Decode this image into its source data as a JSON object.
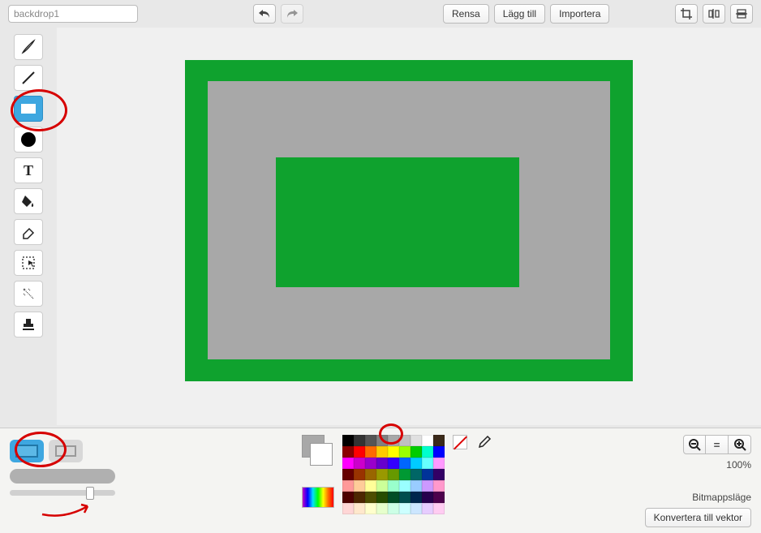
{
  "header": {
    "name_value": "backdrop1",
    "undo": "↶",
    "redo": "↷",
    "buttons": {
      "clear": "Rensa",
      "add": "Lägg till",
      "import": "Importera"
    }
  },
  "tools": {
    "brush": "brush",
    "line": "line",
    "rect": "rect",
    "ellipse": "ellipse",
    "text": "T",
    "fill": "fill",
    "erase": "erase",
    "select": "select",
    "wand": "wand",
    "stamp": "stamp"
  },
  "zoom": {
    "level": "100%"
  },
  "mode": {
    "label": "Bitmappsläge",
    "convert": "Konvertera till vektor"
  },
  "palette": [
    [
      "#000000",
      "#333333",
      "#555555",
      "#808080",
      "#a8a8a8",
      "#c0c0c0",
      "#e0e0e0",
      "#ffffff",
      "#3b2a1a"
    ],
    [
      "#8b0000",
      "#ff0000",
      "#ff6a00",
      "#ffcc00",
      "#ffff00",
      "#99ff00",
      "#00cc00",
      "#00ffcc",
      "#0000ff"
    ],
    [
      "#ff00ff",
      "#cc00cc",
      "#9900cc",
      "#6600cc",
      "#3300ff",
      "#0066ff",
      "#00ccff",
      "#66ffff",
      "#ff99ff"
    ],
    [
      "#660000",
      "#993300",
      "#996600",
      "#999900",
      "#669900",
      "#009933",
      "#006666",
      "#003399",
      "#330066"
    ],
    [
      "#ff9999",
      "#ffcc99",
      "#ffff99",
      "#ccff99",
      "#99ffcc",
      "#99ffff",
      "#99ccff",
      "#cc99ff",
      "#ff99cc"
    ],
    [
      "#4d0000",
      "#4d2600",
      "#4d4d00",
      "#264d00",
      "#004d26",
      "#004d4d",
      "#00264d",
      "#26004d",
      "#4d004d"
    ],
    [
      "#ffd6d6",
      "#ffe8cc",
      "#ffffcc",
      "#e6ffcc",
      "#ccffe6",
      "#ccffff",
      "#cce6ff",
      "#e6ccff",
      "#ffccf2"
    ]
  ]
}
